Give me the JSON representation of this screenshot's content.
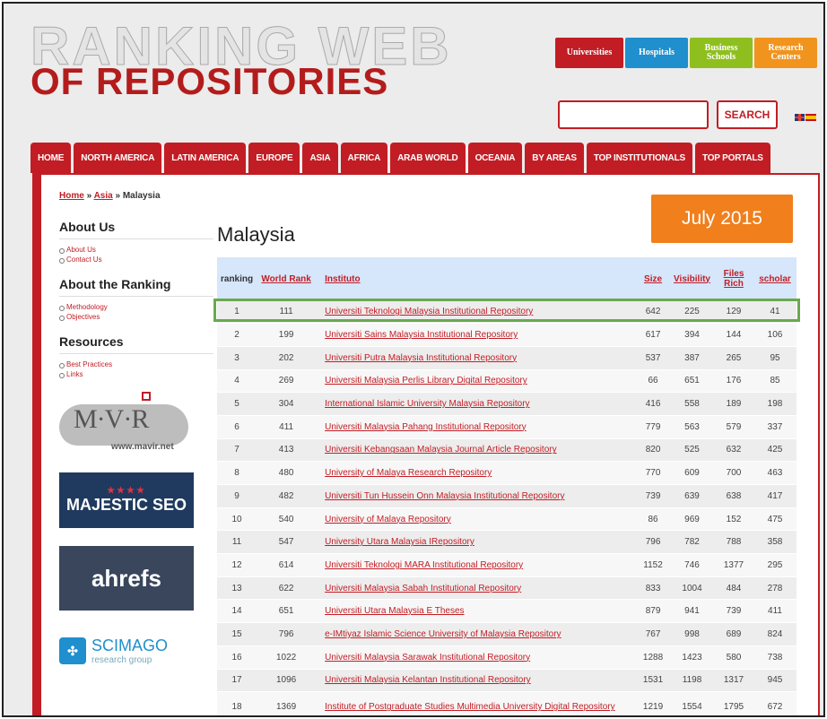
{
  "logo": {
    "line1": "RANKING WEB",
    "line2": "OF REPOSITORIES"
  },
  "categories": [
    {
      "label": "Universities",
      "color": "#c21d24"
    },
    {
      "label": "Hospitals",
      "color": "#1f8fcd"
    },
    {
      "label": "Business Schools",
      "color": "#8fbf1f"
    },
    {
      "label": "Research Centers",
      "color": "#f0941e"
    }
  ],
  "search": {
    "value": "",
    "button": "SEARCH"
  },
  "nav": [
    "HOME",
    "NORTH AMERICA",
    "LATIN AMERICA",
    "EUROPE",
    "ASIA",
    "AFRICA",
    "ARAB WORLD",
    "OCEANIA",
    "BY AREAS",
    "TOP INSTITUTIONALS",
    "TOP PORTALS"
  ],
  "breadcrumb": {
    "home": "Home",
    "sep": "»",
    "asia": "Asia",
    "current": "Malaysia"
  },
  "sidebar": {
    "about_heading": "About Us",
    "about_links": [
      "About Us",
      "Contact Us"
    ],
    "ranking_heading": "About the Ranking",
    "ranking_links": [
      "Methodology",
      "Objectives"
    ],
    "resources_heading": "Resources",
    "resources_links": [
      "Best Practices",
      "Links"
    ],
    "mavir_word": "M·V·R",
    "mavir_url": "www.mavir.net",
    "majestic": "MAJESTIC SEO",
    "ahrefs": "ahrefs",
    "scimago_1": "SCIMAGO",
    "scimago_2": "research group"
  },
  "main": {
    "title": "Malaysia",
    "date_badge": "July 2015"
  },
  "table": {
    "headers": {
      "ranking": "ranking",
      "world_rank": "World Rank",
      "instituto": "Instituto",
      "size": "Size",
      "visibility": "Visibility",
      "files_rich": "Files Rich",
      "scholar": "scholar"
    },
    "rows": [
      {
        "ranking": "1",
        "world": "111",
        "inst": "Universiti Teknologi Malaysia Institutional Repository",
        "size": "642",
        "vis": "225",
        "files": "129",
        "scholar": "41"
      },
      {
        "ranking": "2",
        "world": "199",
        "inst": "Universiti Sains Malaysia Institutional Repository",
        "size": "617",
        "vis": "394",
        "files": "144",
        "scholar": "106"
      },
      {
        "ranking": "3",
        "world": "202",
        "inst": "Universiti Putra Malaysia Institutional Repository",
        "size": "537",
        "vis": "387",
        "files": "265",
        "scholar": "95"
      },
      {
        "ranking": "4",
        "world": "269",
        "inst": "Universiti Malaysia Perlis Library Digital Repository",
        "size": "66",
        "vis": "651",
        "files": "176",
        "scholar": "85"
      },
      {
        "ranking": "5",
        "world": "304",
        "inst": "International Islamic University Malaysia Repository",
        "size": "416",
        "vis": "558",
        "files": "189",
        "scholar": "198"
      },
      {
        "ranking": "6",
        "world": "411",
        "inst": "Universiti Malaysia Pahang Institutional Repository",
        "size": "779",
        "vis": "563",
        "files": "579",
        "scholar": "337"
      },
      {
        "ranking": "7",
        "world": "413",
        "inst": "Universiti Kebangsaan Malaysia Journal Article Repository",
        "size": "820",
        "vis": "525",
        "files": "632",
        "scholar": "425"
      },
      {
        "ranking": "8",
        "world": "480",
        "inst": "University of Malaya Research Repository",
        "size": "770",
        "vis": "609",
        "files": "700",
        "scholar": "463"
      },
      {
        "ranking": "9",
        "world": "482",
        "inst": "Universiti Tun Hussein Onn Malaysia Institutional Repository",
        "size": "739",
        "vis": "639",
        "files": "638",
        "scholar": "417"
      },
      {
        "ranking": "10",
        "world": "540",
        "inst": "University of Malaya Repository",
        "size": "86",
        "vis": "969",
        "files": "152",
        "scholar": "475"
      },
      {
        "ranking": "11",
        "world": "547",
        "inst": "University Utara Malaysia IRepository",
        "size": "796",
        "vis": "782",
        "files": "788",
        "scholar": "358"
      },
      {
        "ranking": "12",
        "world": "614",
        "inst": "Universiti Teknologi MARA Institutional Repository",
        "size": "1152",
        "vis": "746",
        "files": "1377",
        "scholar": "295"
      },
      {
        "ranking": "13",
        "world": "622",
        "inst": "Universiti Malaysia Sabah Institutional Repository",
        "size": "833",
        "vis": "1004",
        "files": "484",
        "scholar": "278"
      },
      {
        "ranking": "14",
        "world": "651",
        "inst": "Universiti Utara Malaysia E Theses",
        "size": "879",
        "vis": "941",
        "files": "739",
        "scholar": "411"
      },
      {
        "ranking": "15",
        "world": "796",
        "inst": "e-IMtiyaz Islamic Science University of Malaysia Repository",
        "size": "767",
        "vis": "998",
        "files": "689",
        "scholar": "824"
      },
      {
        "ranking": "16",
        "world": "1022",
        "inst": "Universiti Malaysia Sarawak Institutional Repository",
        "size": "1288",
        "vis": "1423",
        "files": "580",
        "scholar": "738"
      },
      {
        "ranking": "17",
        "world": "1096",
        "inst": "Universiti Malaysia Kelantan Institutional Repository",
        "size": "1531",
        "vis": "1198",
        "files": "1317",
        "scholar": "945"
      },
      {
        "ranking": "18",
        "world": "1369",
        "inst": "Institute of Postgraduate Studies Multimedia University Digital Repository",
        "size": "1219",
        "vis": "1554",
        "files": "1795",
        "scholar": "672"
      }
    ]
  }
}
